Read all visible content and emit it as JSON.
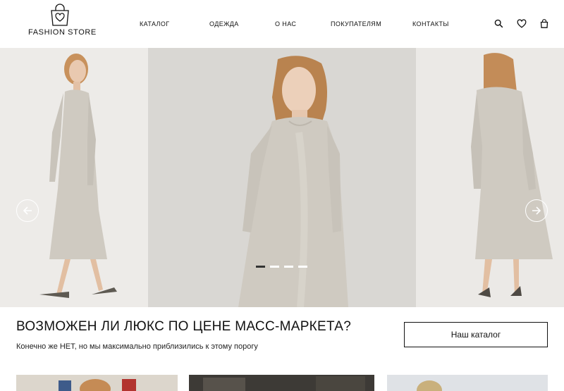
{
  "brand": {
    "name": "FASHION STORE",
    "icon": "heart-bag-icon"
  },
  "nav": {
    "items": [
      {
        "label": "КАТАЛОГ"
      },
      {
        "label": "ОДЕЖДА"
      },
      {
        "label": "О НАС"
      },
      {
        "label": "ПОКУПАТЕЛЯМ"
      },
      {
        "label": "КОНТАКТЫ"
      }
    ]
  },
  "header_icons": [
    "search-icon",
    "heart-icon",
    "bag-icon"
  ],
  "hero": {
    "slides_count": 4,
    "active_slide": 1,
    "prev_icon": "arrow-left-icon",
    "next_icon": "arrow-right-icon"
  },
  "promo": {
    "title": "ВОЗМОЖЕН ЛИ ЛЮКС ПО ЦЕНЕ МАСС-МАРКЕТА?",
    "subtitle": "Конечно же НЕТ, но мы максимально приблизились к этому порогу",
    "button_label": "Наш каталог"
  },
  "colors": {
    "background": "#ffffff",
    "text": "#111111",
    "dress": "#cfcac1",
    "hero_bg": "#e6e4e1",
    "dot_active": "#333333",
    "dot_inactive": "#ffffff"
  }
}
